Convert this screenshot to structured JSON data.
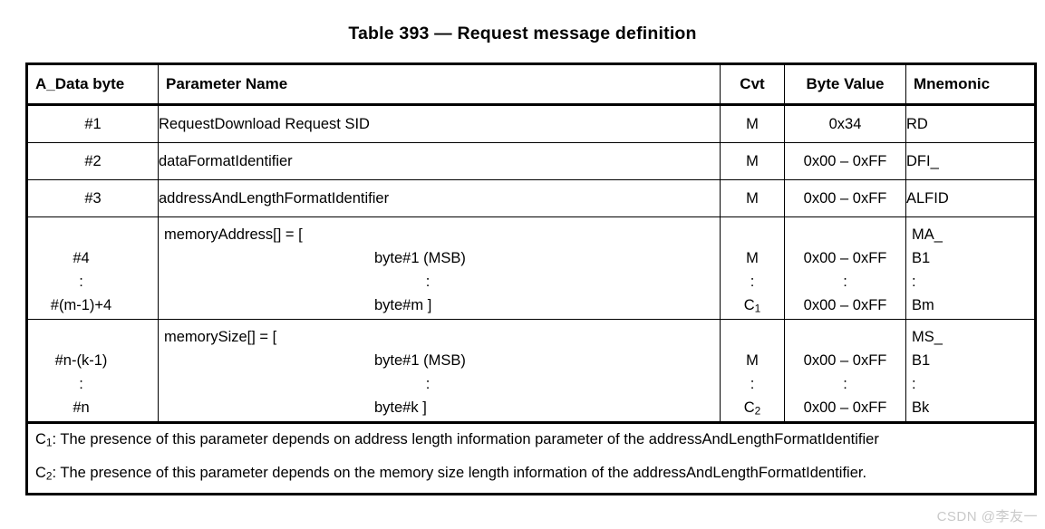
{
  "title": "Table 393 — Request message definition",
  "table": {
    "headers": {
      "a_data_byte": "A_Data byte",
      "parameter_name": "Parameter Name",
      "cvt": "Cvt",
      "byte_value": "Byte Value",
      "mnemonic": "Mnemonic"
    },
    "rows": [
      {
        "a_data_byte": "#1",
        "parameter_name": "RequestDownload Request SID",
        "cvt": "M",
        "byte_value": "0x34",
        "mnemonic": "RD"
      },
      {
        "a_data_byte": "#2",
        "parameter_name": "dataFormatIdentifier",
        "cvt": "M",
        "byte_value": "0x00 – 0xFF",
        "mnemonic": "DFI_"
      },
      {
        "a_data_byte": "#3",
        "parameter_name": "addressAndLengthFormatIdentifier",
        "cvt": "M",
        "byte_value": "0x00 – 0xFF",
        "mnemonic": "ALFID"
      }
    ],
    "array_rows": [
      {
        "a_data_byte_lines": [
          "#4",
          ":",
          "#(m-1)+4"
        ],
        "param_lead": "memoryAddress[] = [",
        "param_lines": [
          "byte#1 (MSB)",
          ":",
          "byte#m ]"
        ],
        "cvt_lines": [
          "M",
          ":",
          "C"
        ],
        "cvt_last_sub": "1",
        "byte_lines": [
          "0x00 – 0xFF",
          ":",
          "0x00 – 0xFF"
        ],
        "mnemonic_lines": [
          "MA_",
          "B1",
          ":",
          "Bm"
        ]
      },
      {
        "a_data_byte_lines": [
          "#n-(k-1)",
          ":",
          "#n"
        ],
        "param_lead": "memorySize[] = [",
        "param_lines": [
          "byte#1 (MSB)",
          ":",
          "byte#k ]"
        ],
        "cvt_lines": [
          "M",
          ":",
          "C"
        ],
        "cvt_last_sub": "2",
        "byte_lines": [
          "0x00 – 0xFF",
          ":",
          "0x00 – 0xFF"
        ],
        "mnemonic_lines": [
          "MS_",
          "B1",
          ":",
          "Bk"
        ]
      }
    ],
    "footnotes": [
      {
        "label": "C",
        "label_sub": "1",
        "text": ": The presence of this parameter depends on address length information parameter of the addressAndLengthFormatIdentifier"
      },
      {
        "label": "C",
        "label_sub": "2",
        "text": ": The presence of this parameter depends on the memory size length information of the addressAndLengthFormatIdentifier."
      }
    ]
  },
  "watermark": "CSDN @李友一"
}
